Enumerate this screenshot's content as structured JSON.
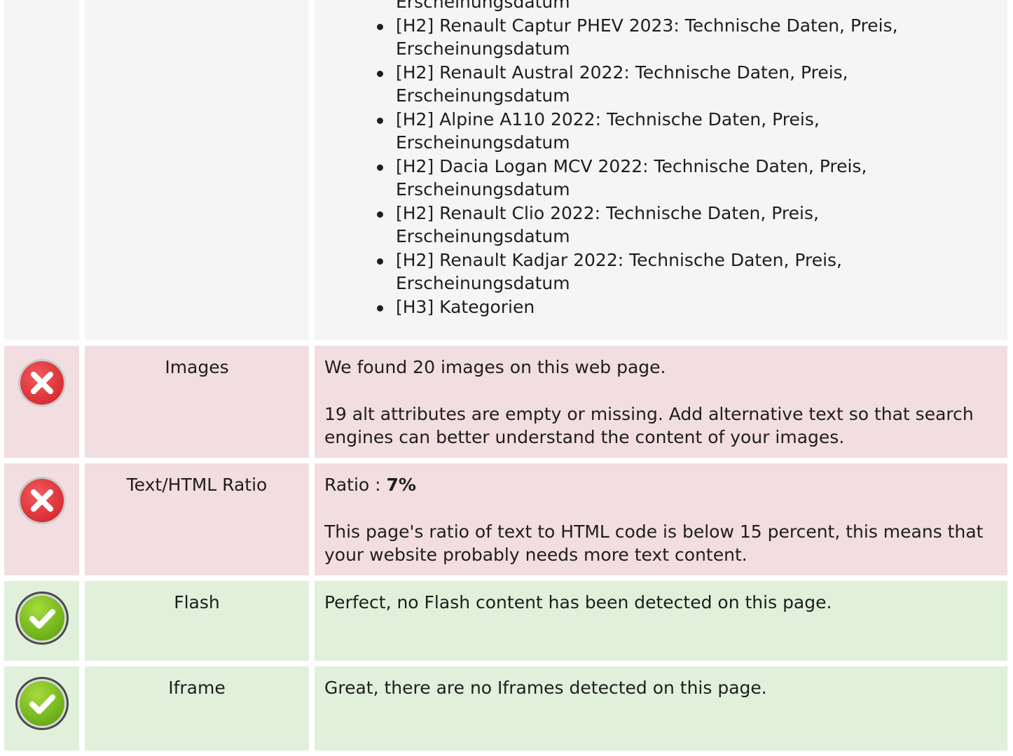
{
  "headings": {
    "items": [
      {
        "text": "Erscheinungsdatum",
        "bullet": false
      },
      {
        "text": "[H2] Renault Captur PHEV 2023: Technische Daten, Preis, Erscheinungsdatum",
        "bullet": true
      },
      {
        "text": "[H2] Renault Austral 2022: Technische Daten, Preis, Erscheinungsdatum",
        "bullet": true
      },
      {
        "text": "[H2] Alpine A110 2022: Technische Daten, Preis, Erscheinungsdatum",
        "bullet": true
      },
      {
        "text": "[H2] Dacia Logan MCV 2022: Technische Daten, Preis, Erscheinungsdatum",
        "bullet": true
      },
      {
        "text": "[H2] Renault Clio 2022: Technische Daten, Preis, Erscheinungsdatum",
        "bullet": true
      },
      {
        "text": "[H2] Renault Kadjar 2022: Technische Daten, Preis, Erscheinungsdatum",
        "bullet": true
      },
      {
        "text": "[H3] Kategorien",
        "bullet": true
      }
    ]
  },
  "checks": {
    "images": {
      "status": "error",
      "label": "Images",
      "line1": "We found 20 images on this web page.",
      "line2": "19 alt attributes are empty or missing. Add alternative text so that search engines can better understand the content of your images."
    },
    "ratio": {
      "status": "error",
      "label": "Text/HTML Ratio",
      "ratio_prefix": "Ratio : ",
      "ratio_value": "7%",
      "line2": "This page's ratio of text to HTML code is below 15 percent, this means that your website probably needs more text content."
    },
    "flash": {
      "status": "ok",
      "label": "Flash",
      "line1": "Perfect, no Flash content has been detected on this page."
    },
    "iframe": {
      "status": "ok",
      "label": "Iframe",
      "line1": "Great, there are no Iframes detected on this page."
    }
  },
  "colors": {
    "error_bg": "#f2dde0",
    "ok_bg": "#e0f0da",
    "neutral_bg": "#f5f5f5",
    "error_icon": "#e0343a",
    "ok_icon": "#7dc01a"
  },
  "icons": {
    "error": "error-x-icon",
    "ok": "checkmark-icon"
  }
}
